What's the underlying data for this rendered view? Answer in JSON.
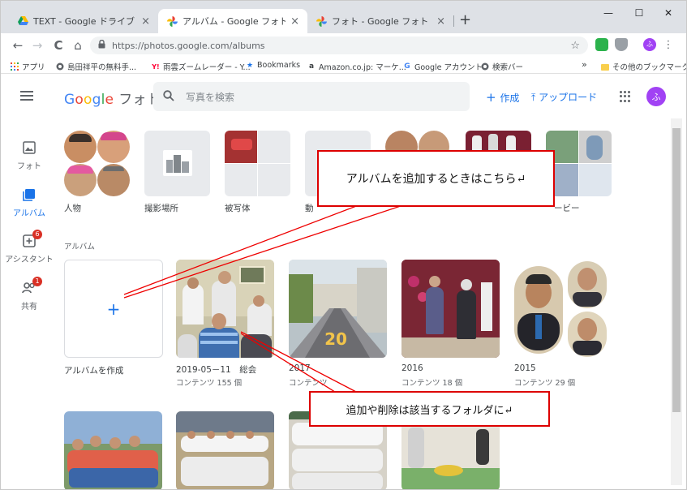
{
  "browser": {
    "tabs": [
      {
        "title": "TEXT - Google ドライブ",
        "close": "×"
      },
      {
        "title": "アルバム - Google フォト",
        "close": "×"
      },
      {
        "title": "フォト - Google フォト",
        "close": "×"
      }
    ],
    "new_tab": "+",
    "window_controls": {
      "minimize": "—",
      "maximize": "☐",
      "close": "✕"
    },
    "nav": {
      "back": "←",
      "forward": "→",
      "reload": "C",
      "home": "⌂"
    },
    "url": "https://photos.google.com/albums",
    "extension_avatar": "ふ",
    "bookmarks": [
      {
        "label": "アプリ",
        "icon": "apps-grid-icon"
      },
      {
        "label": "島田祥平の無料手...",
        "icon": "globe-icon"
      },
      {
        "label": "雨雲ズームレーダー - Y...",
        "icon": "yahoo-icon"
      },
      {
        "label": "Bookmarks",
        "icon": "star-icon"
      },
      {
        "label": "Amazon.co.jp: マーケ...",
        "icon": "amazon-icon"
      },
      {
        "label": "Google アカウント",
        "icon": "google-icon"
      },
      {
        "label": "検索バー",
        "icon": "globe-icon"
      }
    ],
    "bookmarks_more": "»",
    "other_bookmarks": "その他のブックマーク"
  },
  "photos": {
    "logo_google": [
      "G",
      "o",
      "o",
      "g",
      "l",
      "e"
    ],
    "logo_product": "フォト",
    "search_placeholder": "写真を検索",
    "create_label": "作成",
    "upload_label": "アップロード",
    "avatar_initial": "ふ",
    "rail": [
      {
        "label": "フォト",
        "icon": "photo-icon"
      },
      {
        "label": "アルバム",
        "icon": "album-icon"
      },
      {
        "label": "アシスタント",
        "icon": "assistant-icon",
        "badge": "6"
      },
      {
        "label": "共有",
        "icon": "sharing-icon",
        "badge": "1"
      }
    ],
    "top_categories": [
      {
        "label": "人物"
      },
      {
        "label": "撮影場所"
      },
      {
        "label": "被写体"
      },
      {
        "label": "動"
      },
      {
        "label": "ービー"
      }
    ],
    "albums_section_title": "アルバム",
    "create_album_label": "アルバムを作成",
    "create_album_plus": "+",
    "albums": [
      {
        "title": "2019-05－11　総会",
        "count": "コンテンツ 155 個"
      },
      {
        "title": "2017",
        "count": "コンテンツ"
      },
      {
        "title": "2016",
        "count": "コンテンツ 18 個"
      },
      {
        "title": "2015",
        "count": "コンテンツ 29 個"
      }
    ]
  },
  "annotations": {
    "callout_add": "アルバムを追加するときはこちら↵",
    "callout_edit": "追加や削除は該当するフォルダに↵"
  },
  "colors": {
    "accent": "#1a73e8",
    "callout_border": "#dd0000",
    "badge": "#d93025",
    "avatar": "#a142f4"
  }
}
